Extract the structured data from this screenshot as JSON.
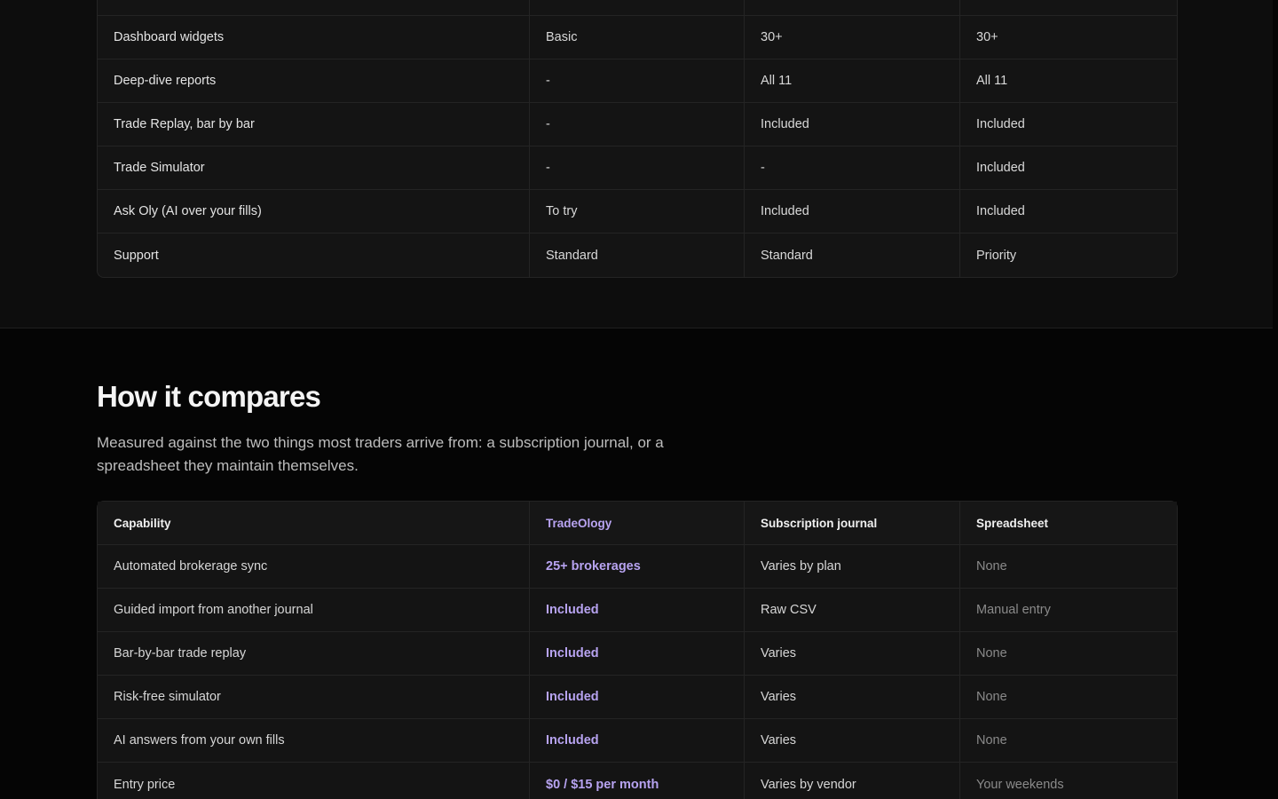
{
  "features": {
    "partial_row": [
      "",
      "",
      "",
      ""
    ],
    "rows": [
      {
        "feature": "Dashboard widgets",
        "free": "Basic",
        "pro": "30+",
        "elite": "30+"
      },
      {
        "feature": "Deep-dive reports",
        "free": "-",
        "pro": "All 11",
        "elite": "All 11"
      },
      {
        "feature": "Trade Replay, bar by bar",
        "free": "-",
        "pro": "Included",
        "elite": "Included"
      },
      {
        "feature": "Trade Simulator",
        "free": "-",
        "pro": "-",
        "elite": "Included"
      },
      {
        "feature": "Ask Oly (AI over your fills)",
        "free": "To try",
        "pro": "Included",
        "elite": "Included"
      },
      {
        "feature": "Support",
        "free": "Standard",
        "pro": "Standard",
        "elite": "Priority"
      }
    ]
  },
  "compare": {
    "title": "How it compares",
    "description": "Measured against the two things most traders arrive from: a subscription journal, or a spreadsheet they maintain themselves.",
    "headers": {
      "capability": "Capability",
      "ours": "TradeOlogy",
      "subscription": "Subscription journal",
      "spreadsheet": "Spreadsheet"
    },
    "rows": [
      {
        "capability": "Automated brokerage sync",
        "ours": "25+ brokerages",
        "subscription": "Varies by plan",
        "spreadsheet": "None"
      },
      {
        "capability": "Guided import from another journal",
        "ours": "Included",
        "subscription": "Raw CSV",
        "spreadsheet": "Manual entry"
      },
      {
        "capability": "Bar-by-bar trade replay",
        "ours": "Included",
        "subscription": "Varies",
        "spreadsheet": "None"
      },
      {
        "capability": "Risk-free simulator",
        "ours": "Included",
        "subscription": "Varies",
        "spreadsheet": "None"
      },
      {
        "capability": "AI answers from your own fills",
        "ours": "Included",
        "subscription": "Varies",
        "spreadsheet": "None"
      },
      {
        "capability": "Entry price",
        "ours": "$0 / $15 per month",
        "subscription": "Varies by vendor",
        "spreadsheet": "Your weekends"
      }
    ]
  },
  "colors": {
    "accent": "#b7a3f0",
    "page_background": "#050505",
    "section_background": "#0d0d0d"
  }
}
